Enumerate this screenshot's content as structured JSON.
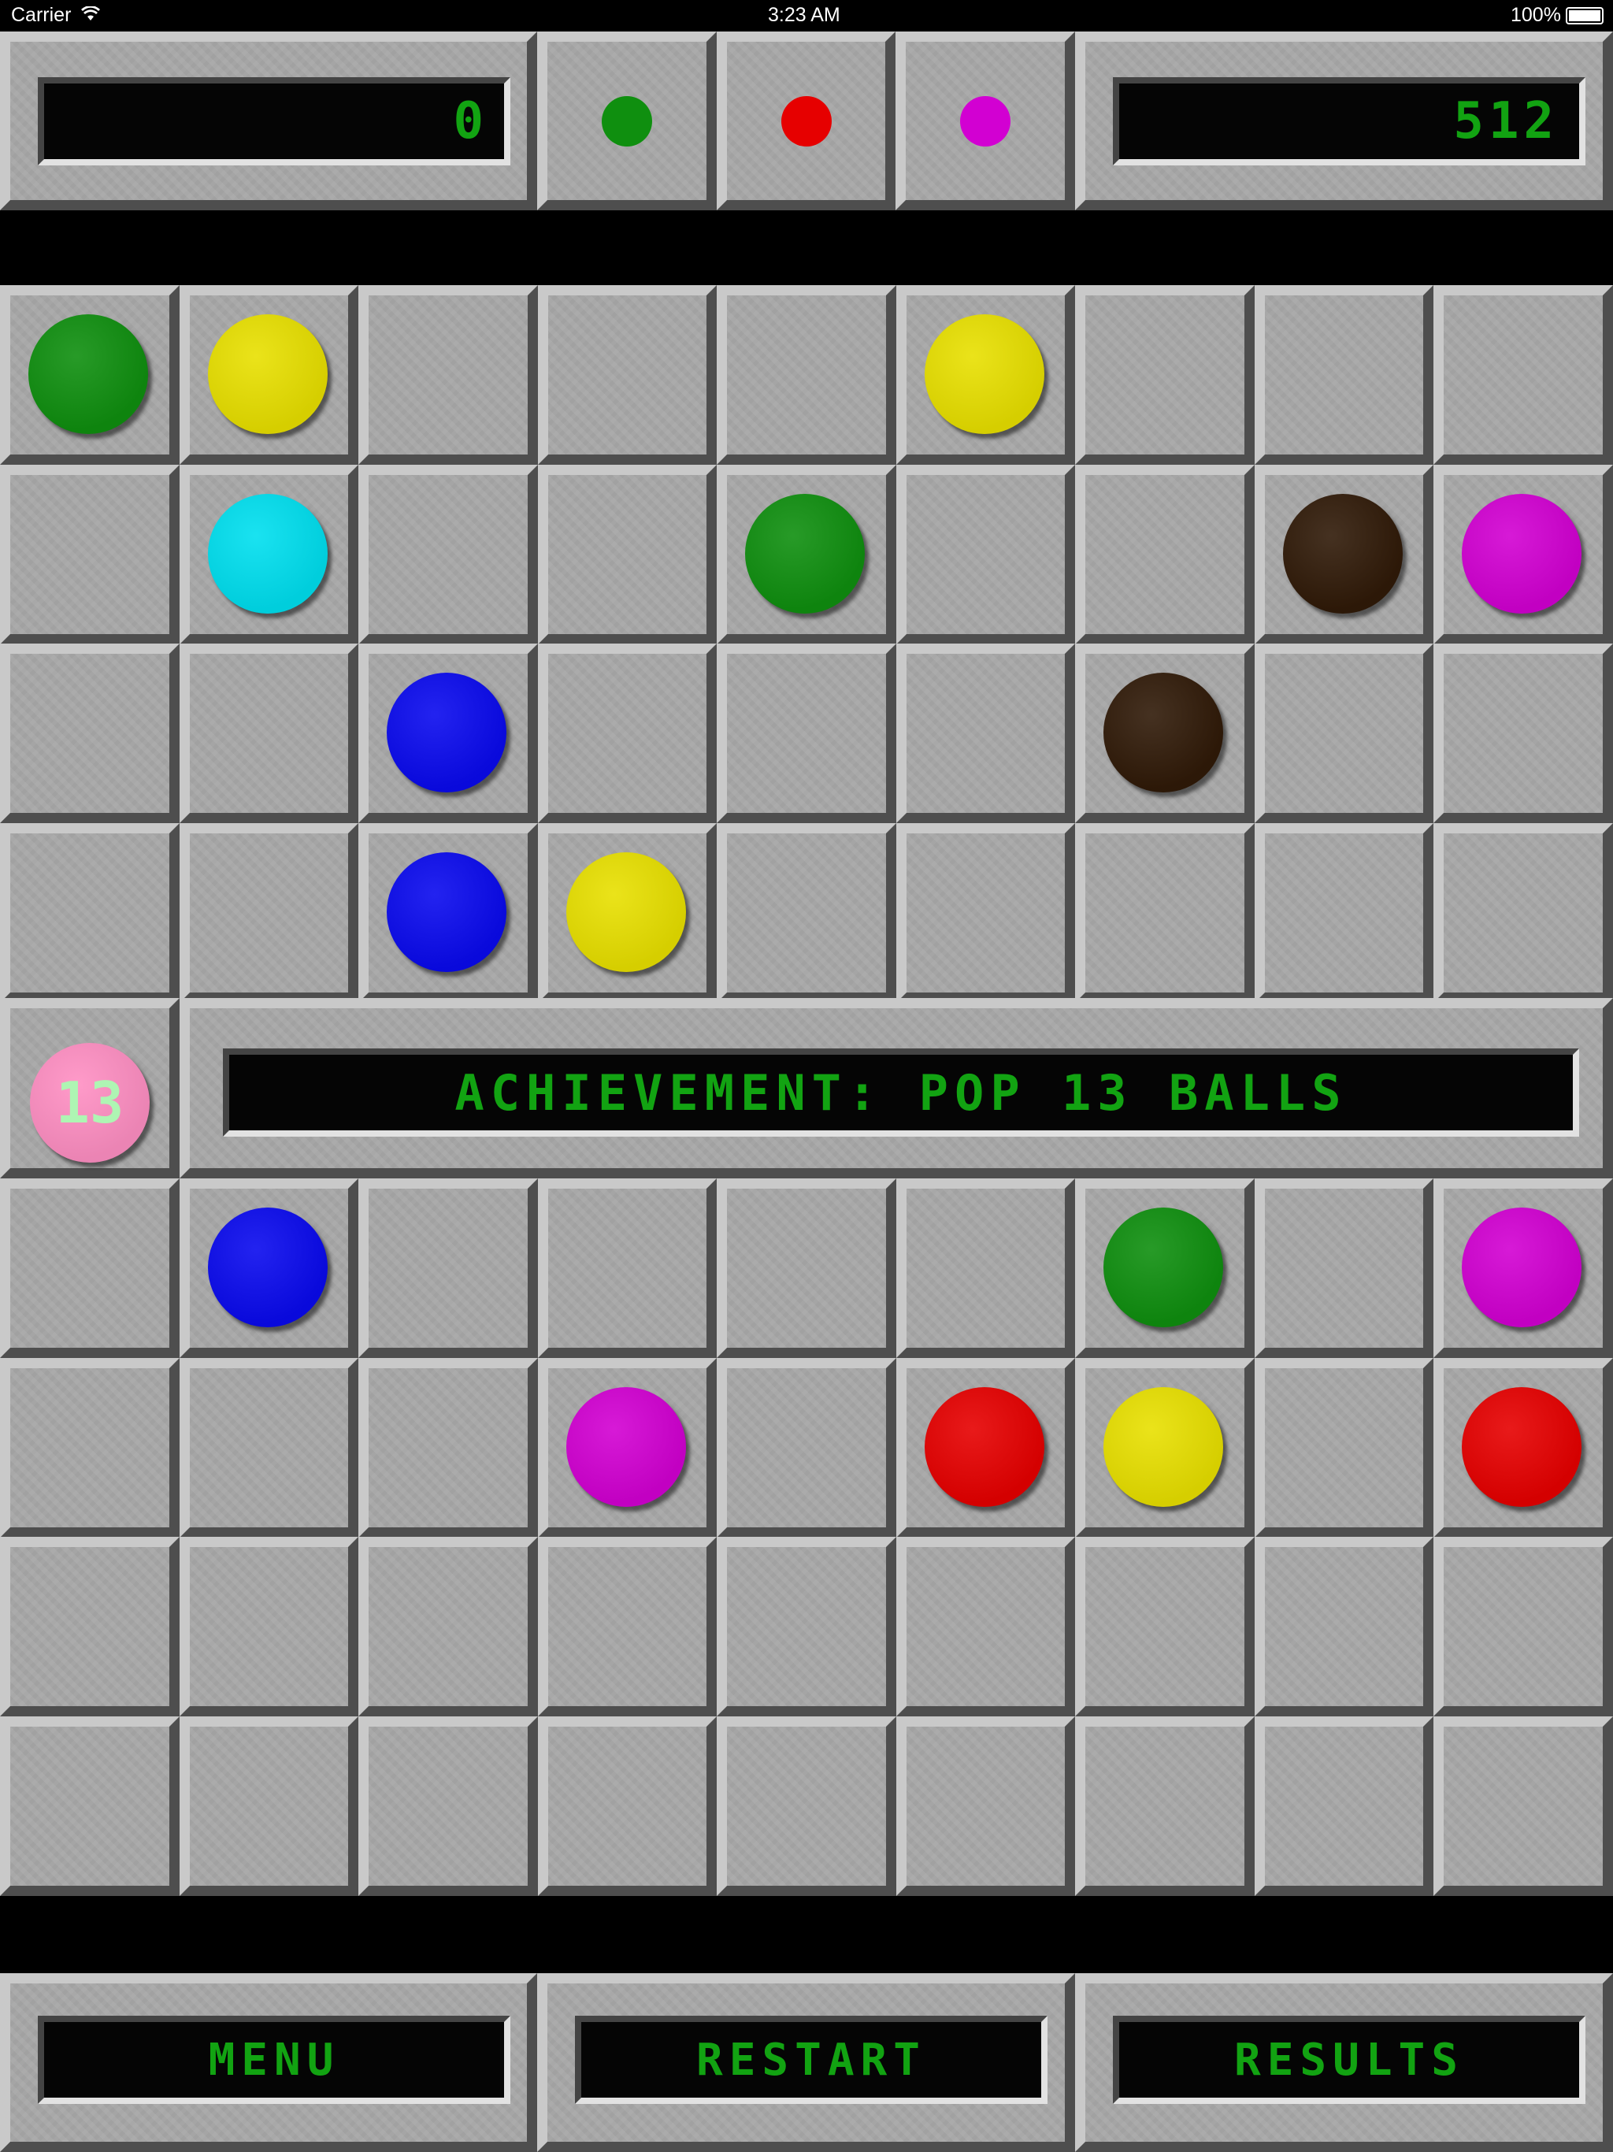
{
  "status_bar": {
    "carrier": "Carrier",
    "time": "3:23 AM",
    "battery": "100%"
  },
  "header": {
    "score": "0",
    "next_balls": [
      {
        "color": "#0f8f0f",
        "icon": "green-ball-icon"
      },
      {
        "color": "#e60000",
        "icon": "red-ball-icon"
      },
      {
        "color": "#d200d2",
        "icon": "magenta-ball-icon"
      }
    ],
    "high_score": "512"
  },
  "board": {
    "columns": 9,
    "rows": 9,
    "palette": {
      "green": "#0f8f0f",
      "yellow": "#e8e000",
      "cyan": "#00dfef",
      "blue": "#0a0aee",
      "dark_brown": "#301a08",
      "magenta": "#d200d2",
      "red": "#e60000"
    },
    "grid": [
      [
        "green",
        "yellow",
        "",
        "",
        "",
        "yellow",
        "",
        "",
        ""
      ],
      [
        "",
        "cyan",
        "",
        "",
        "green",
        "",
        "",
        "dark_brown",
        "magenta"
      ],
      [
        "",
        "",
        "blue",
        "",
        "",
        "",
        "dark_brown",
        "",
        ""
      ],
      [
        "",
        "",
        "blue",
        "yellow",
        "",
        "",
        "",
        "",
        ""
      ],
      [
        "",
        "",
        "",
        "",
        "",
        "",
        "",
        "",
        ""
      ],
      [
        "",
        "blue",
        "",
        "",
        "",
        "",
        "green",
        "",
        "magenta"
      ],
      [
        "",
        "",
        "",
        "magenta",
        "",
        "red",
        "yellow",
        "",
        "red"
      ],
      [
        "",
        "",
        "",
        "",
        "",
        "",
        "",
        "",
        ""
      ],
      [
        "",
        "",
        "",
        "",
        "",
        "",
        "",
        "",
        ""
      ]
    ]
  },
  "achievement": {
    "badge_number": "13",
    "badge_color": "#ff8fc3",
    "badge_text_color": "#aef5b3",
    "message": "ACHIEVEMENT: POP 13 BALLS"
  },
  "footer": {
    "menu_label": "MENU",
    "restart_label": "RESTART",
    "results_label": "RESULTS"
  },
  "colors": {
    "lcd_text": "#12a312",
    "panel": "#a8a8a8"
  }
}
